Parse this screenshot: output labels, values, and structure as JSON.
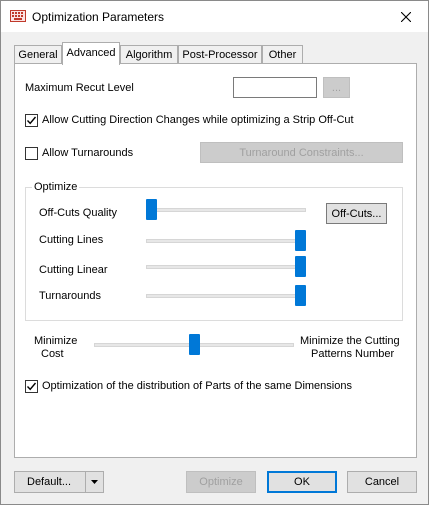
{
  "window": {
    "title": "Optimization Parameters",
    "app_icon": "keyboard-icon",
    "close_icon": "close-icon"
  },
  "tabs": [
    {
      "label": "General",
      "active": false
    },
    {
      "label": "Advanced",
      "active": true
    },
    {
      "label": "Algorithm",
      "active": false
    },
    {
      "label": "Post-Processor",
      "active": false
    },
    {
      "label": "Other",
      "active": false
    }
  ],
  "advanced": {
    "max_recut_label": "Maximum Recut Level",
    "max_recut_value": "",
    "browse_label": "...",
    "allow_direction_changes": {
      "label": "Allow Cutting Direction Changes while optimizing a Strip Off-Cut",
      "checked": true
    },
    "allow_turnarounds": {
      "label": "Allow Turnarounds",
      "checked": false
    },
    "turnaround_constraints_label": "Turnaround Constraints...",
    "optimize_group": {
      "title": "Optimize",
      "offcuts_button_label": "Off-Cuts...",
      "sliders": [
        {
          "label": "Off-Cuts Quality",
          "value": 0.0
        },
        {
          "label": "Cutting Lines",
          "value": 1.0
        },
        {
          "label": "Cutting Linear",
          "value": 1.0
        },
        {
          "label": "Turnarounds",
          "value": 1.0
        }
      ]
    },
    "balance": {
      "left_label_line1": "Minimize",
      "left_label_line2": "Cost",
      "right_label_line1": "Minimize the Cutting",
      "right_label_line2": "Patterns Number",
      "value": 0.5
    },
    "distribution": {
      "label": "Optimization of the distribution of Parts of the same Dimensions",
      "checked": true
    }
  },
  "footer": {
    "default_label": "Default...",
    "optimize_label": "Optimize",
    "ok_label": "OK",
    "cancel_label": "Cancel"
  },
  "colors": {
    "accent": "#0078d7",
    "disabled_text": "#a0a0a0"
  }
}
